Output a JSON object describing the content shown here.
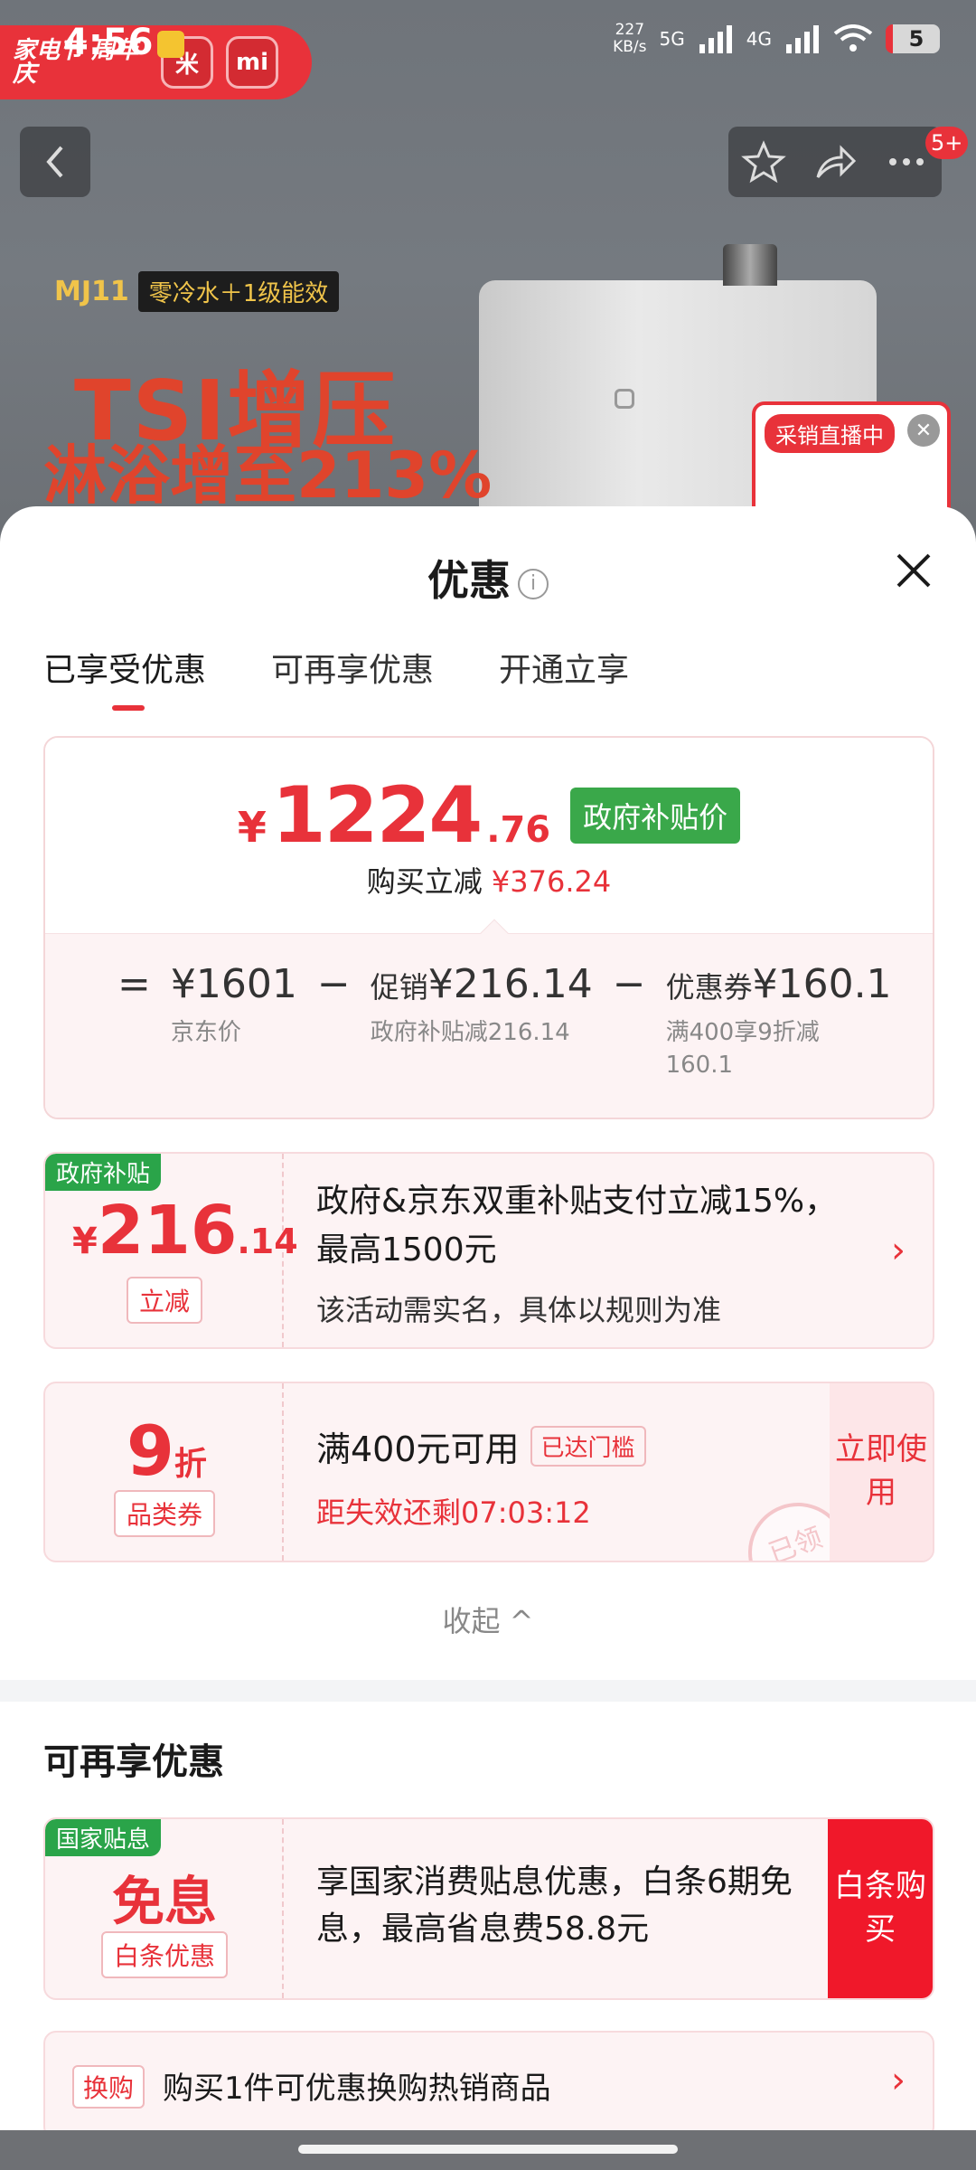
{
  "status_bar": {
    "time": "4:56",
    "net_speed": "227",
    "net_unit": "KB/s",
    "sig1": "5G",
    "sig2": "4G",
    "battery": "5"
  },
  "background": {
    "brand_tag": "家电节 周年庆",
    "brand_icon1": "米",
    "brand_icon2": "mi",
    "model": "MJ11",
    "model_tag": "零冷水＋1级能效",
    "headline1": "TSI增压",
    "headline2": "淋浴增至213%",
    "live_label": "采销直播中",
    "cart_badge": "5+"
  },
  "sheet": {
    "title": "优惠",
    "tabs": [
      "已享受优惠",
      "可再享优惠",
      "开通立享"
    ],
    "price_card": {
      "yen": "¥",
      "price_int": "1224",
      "price_dec": ".76",
      "gov_badge": "政府补贴价",
      "save_label": "购买立减",
      "save_amount": "¥376.24",
      "eq": "=",
      "minus": "−",
      "jd_price": "¥1601",
      "jd_price_label": "京东价",
      "promo_label": "促销",
      "promo_amount": "¥216.14",
      "promo_sub": "政府补贴减216.14",
      "coupon_label": "优惠券",
      "coupon_amount": "¥160.1",
      "coupon_sub1": "满400享9折减",
      "coupon_sub2": "160.1"
    },
    "gov_coupon": {
      "corner": "政府补贴",
      "yen": "¥",
      "amount_int": "216",
      "amount_dec": ".14",
      "tag": "立减",
      "title": "政府&京东双重补贴支付立减15%，最高1500元",
      "desc": "该活动需实名，具体以规则为准"
    },
    "discount_coupon": {
      "num": "9",
      "unit": "折",
      "tag": "品类券",
      "title": "满400元可用",
      "reach_tag": "已达门槛",
      "countdown": "距失效还剩07:03:12",
      "use_btn": "立即使用",
      "stamp": "已领"
    },
    "collapse": "收起 ^",
    "section2_title": "可再享优惠",
    "interest_coupon": {
      "corner": "国家贴息",
      "free": "免息",
      "tag": "白条优惠",
      "title": "享国家消费贴息优惠，白条6期免息，最高省息费58.8元",
      "buy_btn": "白条购买"
    },
    "exchange": {
      "tag": "换购",
      "text": "购买1件可优惠换购热销商品"
    }
  },
  "colors": {
    "accent": "#e8323a",
    "gov_green": "#3aa84a",
    "card_bg": "#fdf3f4"
  }
}
